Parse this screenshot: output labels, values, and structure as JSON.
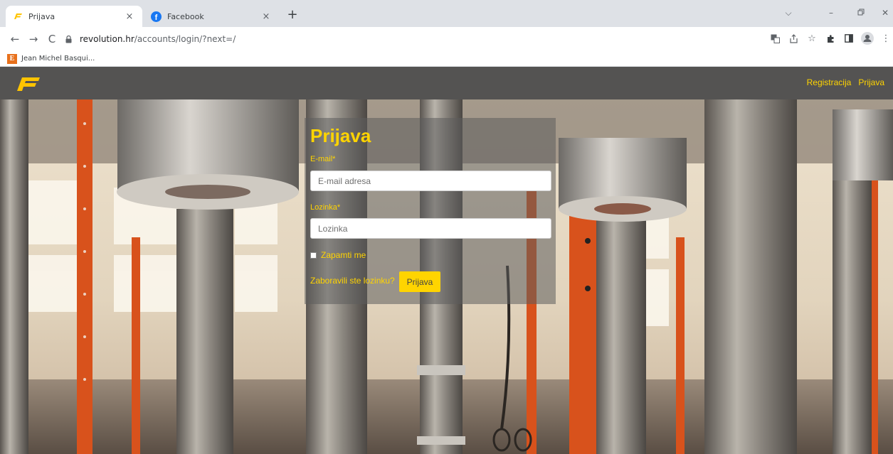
{
  "browser": {
    "tabs": [
      {
        "title": "Prijava",
        "active": true,
        "favicon": "revolution-logo-icon"
      },
      {
        "title": "Facebook",
        "active": false,
        "favicon": "facebook-icon"
      }
    ],
    "url": {
      "domain": "revolution.hr",
      "path": "/accounts/login/?next=/"
    },
    "bookmarks": [
      {
        "label": "Jean Michel Basqui...",
        "icon": "E"
      }
    ],
    "icons": {
      "back": "←",
      "forward": "→",
      "reload": "C",
      "close": "×",
      "new_tab": "+",
      "chevron": "⌵",
      "minimize": "–",
      "restore": "🗗",
      "window_close": "✕",
      "star": "☆",
      "menu": "⋮"
    }
  },
  "site": {
    "accent": "#ffd400",
    "nav": {
      "register": "Registracija",
      "login": "Prijava"
    },
    "form": {
      "title": "Prijava",
      "email_label": "E-mail*",
      "email_placeholder": "E-mail adresa",
      "password_label": "Lozinka*",
      "password_placeholder": "Lozinka",
      "remember_label": "Zapamti me",
      "forgot_label": "Zaboravili ste lozinku?",
      "submit_label": "Prijava"
    }
  }
}
